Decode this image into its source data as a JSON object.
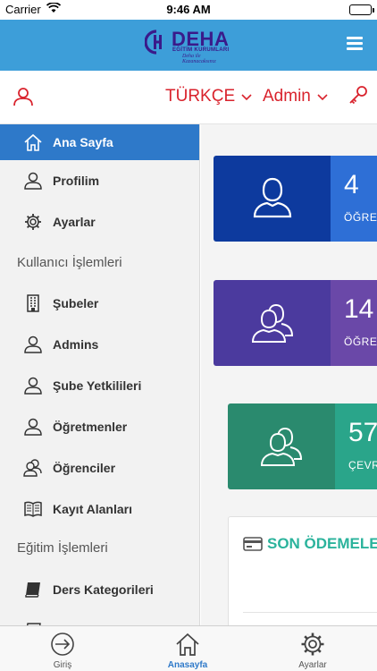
{
  "status_bar": {
    "carrier": "Carrier",
    "time": "9:46 AM"
  },
  "app_bar": {
    "logo": {
      "brand": "DEHA",
      "subtitle": "EĞİTİM KURUMLARI",
      "tagline": "Deha ile Kazanacaksınız"
    },
    "colors": {
      "background": "#3d9ed9",
      "logo": "#3a1a8a"
    }
  },
  "toolbar": {
    "language": "TÜRKÇE",
    "user": "Admin",
    "accent": "#d9232d"
  },
  "sidebar": {
    "items": [
      {
        "label": "Ana Sayfa",
        "icon": "home-icon",
        "active": true
      },
      {
        "label": "Profilim",
        "icon": "user-icon"
      },
      {
        "label": "Ayarlar",
        "icon": "gear-icon"
      }
    ],
    "section_user_ops": "Kullanıcı İşlemleri",
    "user_items": [
      {
        "label": "Şubeler",
        "icon": "building-icon"
      },
      {
        "label": "Admins",
        "icon": "user-icon"
      },
      {
        "label": "Şube Yetkilileri",
        "icon": "user-icon"
      },
      {
        "label": "Öğretmenler",
        "icon": "user-icon"
      },
      {
        "label": "Öğrenciler",
        "icon": "users-icon"
      },
      {
        "label": "Kayıt Alanları",
        "icon": "book-icon"
      }
    ],
    "section_edu_ops": "Eğitim İşlemleri",
    "edu_items": [
      {
        "label": "Ders Kategorileri",
        "icon": "book-closed-icon"
      }
    ]
  },
  "cards": [
    {
      "value": "4",
      "label": "ÖĞRE",
      "icon": "user-icon",
      "left_color": "#0d3a9e",
      "right_color": "#2e6fd6"
    },
    {
      "value": "14",
      "label": "ÖĞRE",
      "icon": "users-icon",
      "left_color": "#4b3a9e",
      "right_color": "#6a48a8"
    },
    {
      "value": "57",
      "label": "ÇEVR",
      "icon": "users-icon",
      "left_color": "#2a8a6e",
      "right_color": "#2aa58a"
    }
  ],
  "payments": {
    "title": "SON ÖDEMELE",
    "icon": "credit-card-icon"
  },
  "tabbar": {
    "tabs": [
      {
        "label": "Giriş",
        "icon": "arrow-right-circle-icon"
      },
      {
        "label": "Anasayfa",
        "icon": "home-icon",
        "active": true
      },
      {
        "label": "Ayarlar",
        "icon": "gear-icon"
      }
    ]
  }
}
